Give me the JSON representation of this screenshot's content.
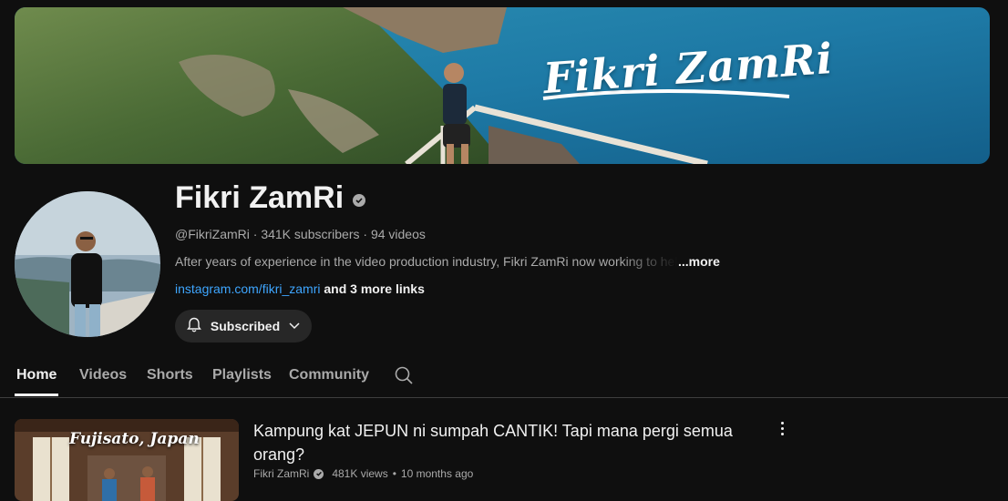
{
  "banner": {
    "title": "Fikri ZamRi"
  },
  "channel": {
    "name": "Fikri ZamRi",
    "handle": "@FikriZamRi",
    "subscribers": "341K subscribers",
    "videos": "94 videos",
    "separator": "·",
    "description": "After years of experience in the video production industry, Fikri ZamRi now working to help",
    "more": "...more",
    "link": "instagram.com/fikri_zamri",
    "more_links": "and 3 more links"
  },
  "subscribe": {
    "label": "Subscribed"
  },
  "tabs": [
    {
      "label": "Home"
    },
    {
      "label": "Videos"
    },
    {
      "label": "Shorts"
    },
    {
      "label": "Playlists"
    },
    {
      "label": "Community"
    }
  ],
  "featured_video": {
    "thumbnail_caption": "Fujisato, Japan",
    "title": "Kampung kat JEPUN ni sumpah CANTIK! Tapi mana pergi semua orang?",
    "channel": "Fikri ZamRi",
    "views": "481K views",
    "age": "10 months ago",
    "separator": "•"
  },
  "colors": {
    "background": "#0f0f0f",
    "text_primary": "#f1f1f1",
    "text_secondary": "#aaaaaa",
    "link": "#3ea6ff",
    "button_bg": "#272727"
  },
  "icons": [
    "verified-icon",
    "bell-icon",
    "chevron-down-icon",
    "search-icon",
    "more-vert-icon"
  ]
}
